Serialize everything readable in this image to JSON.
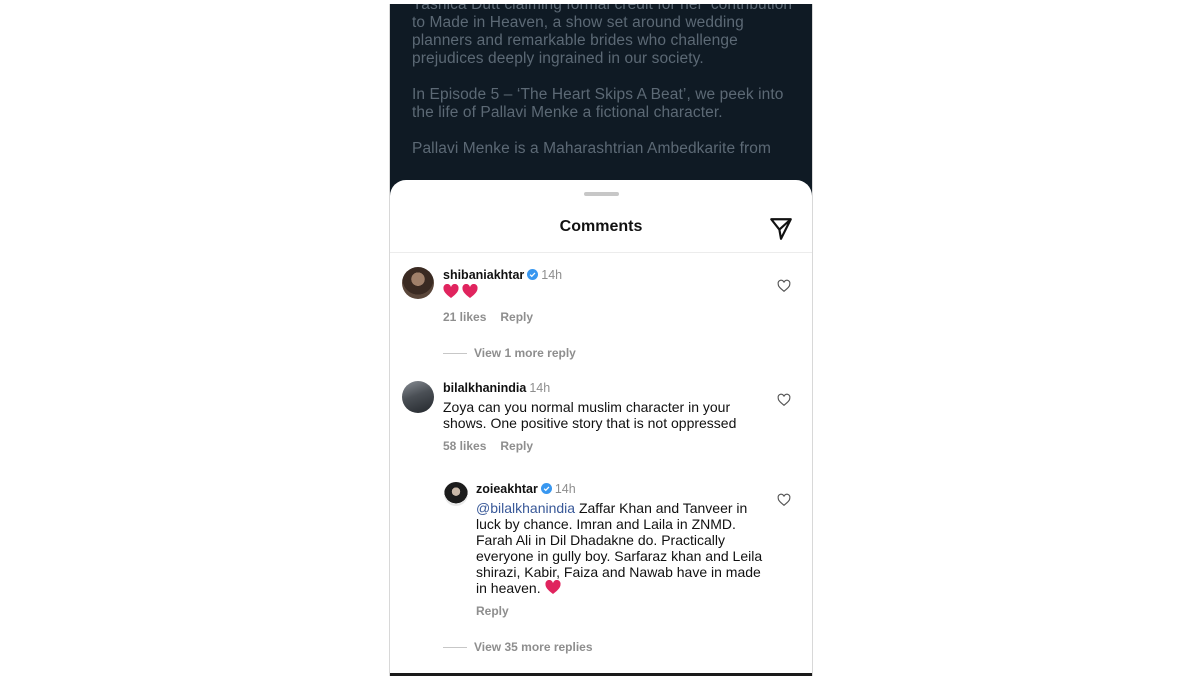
{
  "post_background": {
    "paragraphs": [
      "Yashica Dutt claiming formal credit for her ‘contribution’ to Made in Heaven, a show set around wedding planners and remarkable brides who challenge prejudices deeply ingrained in our society.",
      "In Episode 5 – ‘The Heart Skips A Beat’, we peek into the life of Pallavi Menke a fictional character.",
      "Pallavi Menke is a Maharashtrian Ambedkarite from"
    ]
  },
  "sheet": {
    "title": "Comments",
    "share_icon": "paper-plane-icon"
  },
  "comments": [
    {
      "username": "shibaniakhtar",
      "verified": true,
      "time": "14h",
      "text_emoji": "two-red-hearts",
      "likes": "21 likes",
      "reply_label": "Reply",
      "view_more": "View 1 more reply"
    },
    {
      "username": "bilalkhanindia",
      "verified": false,
      "time": "14h",
      "text": "Zoya can you normal  muslim character in your shows. One positive story that is not oppressed",
      "likes": "58 likes",
      "reply_label": "Reply",
      "replies": [
        {
          "username": "zoieakhtar",
          "verified": true,
          "time": "14h",
          "mention": "@bilalkhanindia",
          "text": "Zaffar Khan and Tanveer in luck by chance. Imran and Laila in ZNMD. Farah Ali in Dil Dhadakne do. Practically everyone in gully boy. Sarfaraz khan and Leila shirazi, Kabir, Faiza and Nawab have in made in heaven.",
          "trailing_emoji": "red-heart",
          "reply_label": "Reply"
        }
      ],
      "view_more": "View 35 more replies"
    }
  ],
  "colors": {
    "verified_badge": "#3897f0",
    "heart_emoji": "#e0245e",
    "mention": "#385898",
    "muted_text": "#8e8e8e"
  }
}
